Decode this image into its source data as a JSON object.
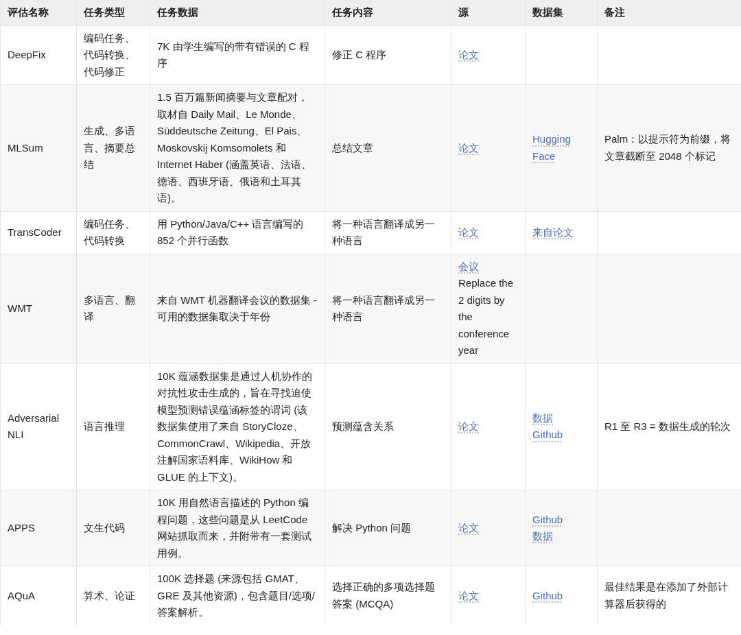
{
  "table": {
    "columns": [
      "评估名称",
      "任务类型",
      "任务数据",
      "任务内容",
      "源",
      "数据集",
      "备注"
    ],
    "rows": [
      {
        "name": "DeepFix",
        "type": "编码任务、代码转换、代码修正",
        "data": "7K 由学生编写的带有错误的 C 程序",
        "content": "修正 C 程序",
        "source": [
          {
            "kind": "link",
            "text": "论文"
          }
        ],
        "dataset": [],
        "note": ""
      },
      {
        "name": "MLSum",
        "type": "生成、多语言、摘要总结",
        "data": "1.5 百万篇新闻摘要与文章配对，取材自 Daily Mail、Le Monde、Süddeutsche Zeitung、El Pais、Moskovskij Komsomolets 和 Internet Haber (涵盖英语、法语、德语、西班牙语、俄语和土耳其语)。",
        "content": "总结文章",
        "source": [
          {
            "kind": "link",
            "text": "论文"
          }
        ],
        "dataset": [
          {
            "kind": "link",
            "text": "Hugging Face"
          }
        ],
        "note": "Palm：以提示符为前缀，将文章截断至 2048 个标记"
      },
      {
        "name": "TransCoder",
        "type": "编码任务、代码转换",
        "data": "用 Python/Java/C++ 语言编写的 852 个并行函数",
        "content": "将一种语言翻译成另一种语言",
        "source": [
          {
            "kind": "link",
            "text": "论文"
          }
        ],
        "dataset": [
          {
            "kind": "link",
            "text": "来自论文"
          }
        ],
        "note": ""
      },
      {
        "name": "WMT",
        "type": "多语言、翻译",
        "data": "来自 WMT 机器翻译会议的数据集 - 可用的数据集取决于年份",
        "content": "将一种语言翻译成另一种语言",
        "source": [
          {
            "kind": "link",
            "text": "会议"
          },
          {
            "kind": "text",
            "text": "Replace the 2 digits by the conference year"
          }
        ],
        "dataset": [],
        "note": ""
      },
      {
        "name": "Adversarial NLI",
        "type": "语言推理",
        "data": "10K 蕴涵数据集是通过人机协作的对抗性攻击生成的，旨在寻找迫使模型预测错误蕴涵标签的谓词 (该数据集使用了来自 StoryCloze、CommonCrawl、Wikipedia、开放注解国家语料库、WikiHow 和 GLUE 的上下文)。",
        "content": "预测蕴含关系",
        "source": [
          {
            "kind": "link",
            "text": "论文"
          }
        ],
        "dataset": [
          {
            "kind": "link",
            "text": "数据"
          },
          {
            "kind": "link",
            "text": "Github"
          }
        ],
        "note": "R1 至 R3 = 数据生成的轮次"
      },
      {
        "name": "APPS",
        "type": "文生代码",
        "data": "10K 用自然语言描述的 Python 编程问题，这些问题是从 LeetCode 网站抓取而来，并附带有一套测试用例。",
        "content": "解决 Python 问题",
        "source": [
          {
            "kind": "link",
            "text": "论文"
          }
        ],
        "dataset": [
          {
            "kind": "link",
            "text": "Github"
          },
          {
            "kind": "link",
            "text": "数据"
          }
        ],
        "note": ""
      },
      {
        "name": "AQuA",
        "type": "算术、论证",
        "data": "100K 选择题 (来源包括 GMAT、GRE 及其他资源)，包含题目/选项/答案解析。",
        "content": "选择正确的多项选择题答案 (MCQA)",
        "source": [
          {
            "kind": "link",
            "text": "论文"
          }
        ],
        "dataset": [
          {
            "kind": "link",
            "text": "Github"
          }
        ],
        "note": "最佳结果是在添加了外部计算器后获得的"
      }
    ]
  }
}
